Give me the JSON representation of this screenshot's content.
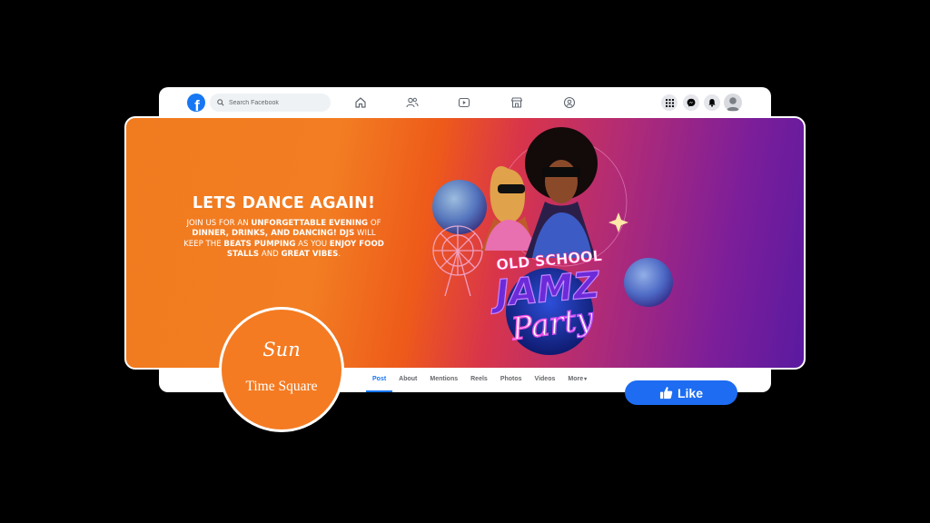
{
  "search": {
    "placeholder": "Search Facebook"
  },
  "nav_icons": [
    "home-icon",
    "friends-icon",
    "watch-icon",
    "marketplace-icon",
    "groups-icon"
  ],
  "header_actions": [
    "menu-grid-icon",
    "messenger-icon",
    "notifications-bell-icon",
    "account-avatar"
  ],
  "cover": {
    "title": "LETS DANCE AGAIN!",
    "body_segments": [
      {
        "t": "JOIN US FOR AN ",
        "b": false
      },
      {
        "t": "UNFORGETTABLE EVENING",
        "b": true
      },
      {
        "t": " OF ",
        "b": false
      },
      {
        "t": "DINNER, DRINKS, AND DANCING! DJS",
        "b": true
      },
      {
        "t": " WILL KEEP THE ",
        "b": false
      },
      {
        "t": "BEATS PUMPING",
        "b": true
      },
      {
        "t": " AS YOU ",
        "b": false
      },
      {
        "t": "ENJOY FOOD STALLS",
        "b": true
      },
      {
        "t": " AND ",
        "b": false
      },
      {
        "t": "GREAT VIBES",
        "b": true
      },
      {
        "t": ".",
        "b": false
      }
    ],
    "art": {
      "line1": "OLD SCHOOL",
      "line2": "JAMZ",
      "line3": "Party"
    }
  },
  "tabs": [
    "Post",
    "About",
    "Mentions",
    "Reels",
    "Photos",
    "Videos",
    "More"
  ],
  "active_tab": "Post",
  "profile": {
    "script": "Sun",
    "name": "Time Square"
  },
  "like_button": {
    "label": "Like"
  },
  "colors": {
    "facebook_blue": "#1877f2",
    "brand_orange": "#f47b22",
    "cover_purple": "#5a1aa0"
  }
}
